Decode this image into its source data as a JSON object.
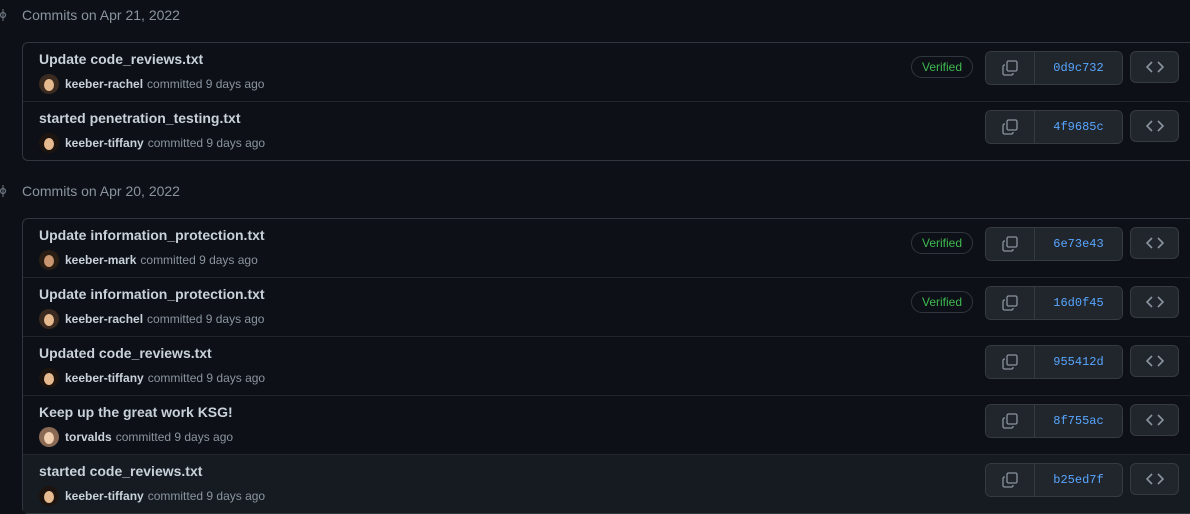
{
  "groups": [
    {
      "title": "Commits on Apr 21, 2022",
      "commits": [
        {
          "message": "Update code_reviews.txt",
          "author": "keeber-rachel",
          "committed": "committed 9 days ago",
          "verified": "Verified",
          "sha": "0d9c732",
          "avatar": "keeber-rachel"
        },
        {
          "message": "started penetration_testing.txt",
          "author": "keeber-tiffany",
          "committed": "committed 9 days ago",
          "verified": "",
          "sha": "4f9685c",
          "avatar": "keeber-tiffany"
        }
      ]
    },
    {
      "title": "Commits on Apr 20, 2022",
      "commits": [
        {
          "message": "Update information_protection.txt",
          "author": "keeber-mark",
          "committed": "committed 9 days ago",
          "verified": "Verified",
          "sha": "6e73e43",
          "avatar": "keeber-mark"
        },
        {
          "message": "Update information_protection.txt",
          "author": "keeber-rachel",
          "committed": "committed 9 days ago",
          "verified": "Verified",
          "sha": "16d0f45",
          "avatar": "keeber-rachel"
        },
        {
          "message": "Updated code_reviews.txt",
          "author": "keeber-tiffany",
          "committed": "committed 9 days ago",
          "verified": "",
          "sha": "955412d",
          "avatar": "keeber-tiffany"
        },
        {
          "message": "Keep up the great work KSG!",
          "author": "torvalds",
          "committed": "committed 9 days ago",
          "verified": "",
          "sha": "8f755ac",
          "avatar": "torvalds"
        },
        {
          "message": "started code_reviews.txt",
          "author": "keeber-tiffany",
          "committed": "committed 9 days ago",
          "verified": "",
          "sha": "b25ed7f",
          "avatar": "keeber-tiffany"
        }
      ]
    }
  ],
  "colors": {
    "background": "#0d1117",
    "verified": "#3fb950",
    "sha_link": "#58a6ff",
    "muted": "#8b949e"
  },
  "icons": {
    "timeline": "git-commit-icon",
    "copy": "copy-icon",
    "browse": "code-icon"
  }
}
